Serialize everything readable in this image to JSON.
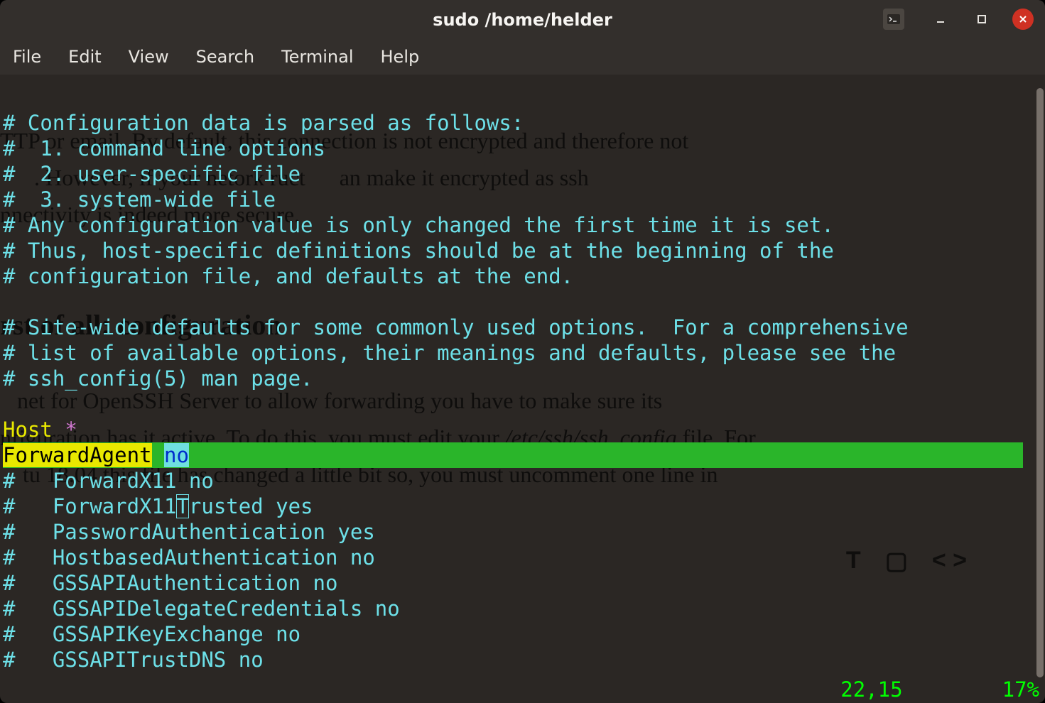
{
  "window": {
    "title": "sudo  /home/helder"
  },
  "menu": {
    "items": [
      "File",
      "Edit",
      "View",
      "Search",
      "Terminal",
      "Help"
    ]
  },
  "file": {
    "lines": [
      "# Configuration data is parsed as follows:",
      "#  1. command line options",
      "#  2. user-specific file",
      "#  3. system-wide file",
      "# Any configuration value is only changed the first time it is set.",
      "# Thus, host-specific definitions should be at the beginning of the",
      "# configuration file, and defaults at the end.",
      "",
      "# Site-wide defaults for some commonly used options.  For a comprehensive",
      "# list of available options, their meanings and defaults, please see the",
      "# ssh_config(5) man page.",
      ""
    ],
    "host_line": {
      "keyword": "Host",
      "pattern": "*"
    },
    "cursor_line": {
      "key": "ForwardAgent",
      "value": "no"
    },
    "rest": [
      "#   ForwardX11 no",
      "#   ForwardX11Trusted yes",
      "#   PasswordAuthentication yes",
      "#   HostbasedAuthentication no",
      "#   GSSAPIAuthentication no",
      "#   GSSAPIDelegateCredentials no",
      "#   GSSAPIKeyExchange no",
      "#   GSSAPITrustDNS no"
    ],
    "rest_caret_line_index": 1,
    "rest_caret_col": 14
  },
  "status": {
    "position": "22,15",
    "percent": "17%"
  },
  "bg_article": {
    "l1a": "TTP or email. By default, this connection is not encrypted and therefore not",
    "l1b": "      . However, if your net",
    "l1c": "ork ",
    "l1d": "ruct",
    "l1e": "      an make it encrypted as ssh",
    "l2": "nnectivity is indeed more secure.",
    "hdr": "rst of all: configuration",
    "p2a": "   net for OpenSSH Server to allow forwarding you have to make sure its",
    "p2b": "nfiguration has it active. To do this, you must edit your ",
    "p2b_i": "/etc/ssh/ssh_config",
    "p2b_end": " file. For",
    "p2c": "    tu 18.04 this file has changed a little bit so, you must uncomment one line in"
  },
  "float_icons": {
    "t": "T",
    "img": "▢",
    "code": "< >"
  }
}
